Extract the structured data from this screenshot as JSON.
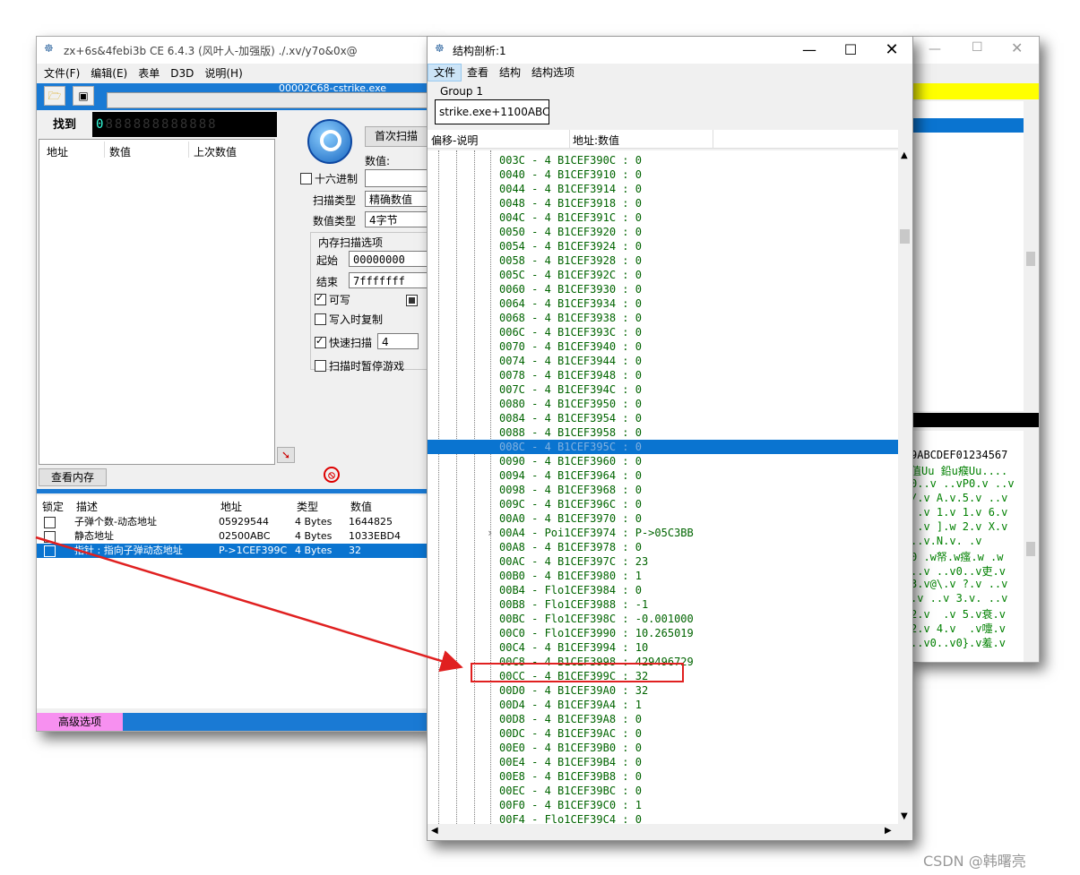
{
  "ce_window": {
    "title": "zx+6s&4febi3b  CE 6.4.3 (风叶人-加强版)  ./.xv/y7o&0x@",
    "menu": [
      "文件(F)",
      "编辑(E)",
      "表单",
      "D3D",
      "说明(H)"
    ],
    "process_name": "00002C68-cstrike.exe",
    "found_label": "找到",
    "found_digits": "0",
    "list_headers": [
      "地址",
      "数值",
      "上次数值"
    ],
    "first_scan_label": "首次扫描",
    "value_label": "数值:",
    "hex_label": "十六进制",
    "scan_type_label": "扫描类型",
    "scan_type_value": "精确数值",
    "value_type_label": "数值类型",
    "value_type_value": "4字节",
    "mem_options_label": "内存扫描选项",
    "start_label": "起始",
    "start_value": "00000000",
    "end_label": "结束",
    "end_value": "7fffffff",
    "writable_label": "可写",
    "cow_label": "写入时复制",
    "fast_scan_label": "快速扫描",
    "fast_scan_value": "4",
    "pause_label": "扫描时暂停游戏",
    "view_memory_label": "查看内存",
    "advanced_label": "高级选项",
    "table_headers": [
      "锁定",
      "描述",
      "地址",
      "类型",
      "数值"
    ],
    "table_rows": [
      {
        "desc": "子弹个数-动态地址",
        "addr": "05929544",
        "type": "4 Bytes",
        "value": "1644825",
        "selected": false
      },
      {
        "desc": "静态地址",
        "addr": "02500ABC",
        "type": "4 Bytes",
        "value": "1033EBD4",
        "selected": false
      },
      {
        "desc": "指针 : 指向子弹动态地址",
        "addr": "P->1CEF399C",
        "type": "4 Bytes",
        "value": "32",
        "selected": true
      }
    ]
  },
  "struct_window": {
    "title": "结构剖析:1",
    "menu": [
      "文件",
      "查看",
      "结构",
      "结构选项"
    ],
    "group_label": "Group 1",
    "group_address": "strike.exe+1100ABC",
    "col_offset": "偏移-说明",
    "col_addr": "地址:数值",
    "rows": [
      {
        "t": "003C - 4 B1CEF390C : 0"
      },
      {
        "t": "0040 - 4 B1CEF3910 : 0"
      },
      {
        "t": "0044 - 4 B1CEF3914 : 0"
      },
      {
        "t": "0048 - 4 B1CEF3918 : 0"
      },
      {
        "t": "004C - 4 B1CEF391C : 0"
      },
      {
        "t": "0050 - 4 B1CEF3920 : 0"
      },
      {
        "t": "0054 - 4 B1CEF3924 : 0"
      },
      {
        "t": "0058 - 4 B1CEF3928 : 0"
      },
      {
        "t": "005C - 4 B1CEF392C : 0"
      },
      {
        "t": "0060 - 4 B1CEF3930 : 0"
      },
      {
        "t": "0064 - 4 B1CEF3934 : 0"
      },
      {
        "t": "0068 - 4 B1CEF3938 : 0"
      },
      {
        "t": "006C - 4 B1CEF393C : 0"
      },
      {
        "t": "0070 - 4 B1CEF3940 : 0"
      },
      {
        "t": "0074 - 4 B1CEF3944 : 0"
      },
      {
        "t": "0078 - 4 B1CEF3948 : 0"
      },
      {
        "t": "007C - 4 B1CEF394C : 0"
      },
      {
        "t": "0080 - 4 B1CEF3950 : 0"
      },
      {
        "t": "0084 - 4 B1CEF3954 : 0"
      },
      {
        "t": "0088 - 4 B1CEF3958 : 0"
      },
      {
        "t": "008C - 4 B1CEF395C : 0",
        "sel": true
      },
      {
        "t": "0090 - 4 B1CEF3960 : 0"
      },
      {
        "t": "0094 - 4 B1CEF3964 : 0"
      },
      {
        "t": "0098 - 4 B1CEF3968 : 0"
      },
      {
        "t": "009C - 4 B1CEF396C : 0"
      },
      {
        "t": "00A0 - 4 B1CEF3970 : 0"
      },
      {
        "t": "00A4 - Poi1CEF3974 : P->05C3BB",
        "expand": true
      },
      {
        "t": "00A8 - 4 B1CEF3978 : 0"
      },
      {
        "t": "00AC - 4 B1CEF397C : 23"
      },
      {
        "t": "00B0 - 4 B1CEF3980 : 1"
      },
      {
        "t": "00B4 - Flo1CEF3984 : 0"
      },
      {
        "t": "00B8 - Flo1CEF3988 : -1"
      },
      {
        "t": "00BC - Flo1CEF398C : -0.001000"
      },
      {
        "t": "00C0 - Flo1CEF3990 : 10.265019"
      },
      {
        "t": "00C4 - 4 B1CEF3994 : 10"
      },
      {
        "t": "00C8 - 4 B1CEF3998 : 429496729"
      },
      {
        "t": "00CC - 4 B1CEF399C : 32",
        "highlight": true
      },
      {
        "t": "00D0 - 4 B1CEF39A0 : 32"
      },
      {
        "t": "00D4 - 4 B1CEF39A4 : 1"
      },
      {
        "t": "00D8 - 4 B1CEF39A8 : 0"
      },
      {
        "t": "00DC - 4 B1CEF39AC : 0"
      },
      {
        "t": "00E0 - 4 B1CEF39B0 : 0"
      },
      {
        "t": "00E4 - 4 B1CEF39B4 : 0"
      },
      {
        "t": "00E8 - 4 B1CEF39B8 : 0"
      },
      {
        "t": "00EC - 4 B1CEF39BC : 0"
      },
      {
        "t": "00F0 - 4 B1CEF39C0 : 1"
      },
      {
        "t": "00F4 - Flo1CEF39C4 : 0"
      }
    ]
  },
  "hex_window": {
    "header": "9ABCDEF01234567",
    "lines": [
      "值Uu 鉛u瘊Uu....",
      "0..v ..vP0.v ..v",
      "/.v A.v.5.v ..v",
      " .v 1.v 1.v 6.v",
      " .v ].w 2.v X.v",
      "..v.N.v. .v",
      "0 .w帑.w瘙.w .w",
      "..v ..v0..v吏.v",
      "3.v@\\.v ?.v ..v",
      ".v ..v 3.v. ..v",
      "2.v  .v 5.v衰.v",
      "2.v 4.v  .v嚏.v",
      "..v0..v0}.v羞.v"
    ]
  },
  "watermark": "CSDN @韩曙亮"
}
